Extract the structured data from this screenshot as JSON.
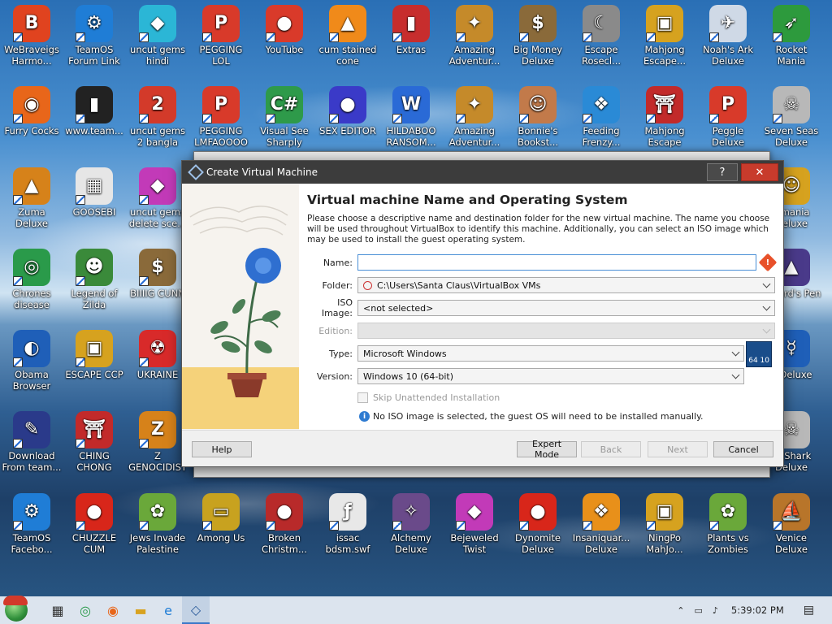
{
  "desktop": {
    "icons": [
      {
        "label": "WeBraveigs Harmo...",
        "color": "#e0431f",
        "glyph": "B"
      },
      {
        "label": "TeamOS Forum Link",
        "color": "#1f7dd6",
        "glyph": "⚙"
      },
      {
        "label": "uncut gems hindi",
        "color": "#2bb6d6",
        "glyph": "◆"
      },
      {
        "label": "PEGGING LOL",
        "color": "#d83a2a",
        "glyph": "P"
      },
      {
        "label": "YouTube",
        "color": "#d93a2a",
        "glyph": "●"
      },
      {
        "label": "cum stained cone",
        "color": "#f08a1a",
        "glyph": "▲"
      },
      {
        "label": "Extras",
        "color": "#c72d2d",
        "glyph": "▮"
      },
      {
        "label": "Amazing Adventur...",
        "color": "#c58a2a",
        "glyph": "✦"
      },
      {
        "label": "Big Money Deluxe",
        "color": "#8a6a3a",
        "glyph": "$"
      },
      {
        "label": "Escape Rosecl...",
        "color": "#8a8a8a",
        "glyph": "☾"
      },
      {
        "label": "Mahjong Escape...",
        "color": "#d6a21f",
        "glyph": "▣"
      },
      {
        "label": "Noah's Ark Deluxe",
        "color": "#cfd9e6",
        "glyph": "✈"
      },
      {
        "label": "Rocket Mania Deluxe",
        "color": "#2d9a3d",
        "glyph": "➶"
      },
      {
        "label": "Furry Cocks",
        "color": "#e8661a",
        "glyph": "◉"
      },
      {
        "label": "www.team...",
        "color": "#222222",
        "glyph": "▮"
      },
      {
        "label": "uncut gems 2 bangla",
        "color": "#d33a2a",
        "glyph": "2"
      },
      {
        "label": "PEGGING LMFAOOOO",
        "color": "#d83a2a",
        "glyph": "P"
      },
      {
        "label": "Visual See Sharply Eve...",
        "color": "#2e9a4a",
        "glyph": "C#"
      },
      {
        "label": "SEX EDITOR",
        "color": "#3a3ac8",
        "glyph": "●"
      },
      {
        "label": "HILDABOO RANSOM...",
        "color": "#2a6ad6",
        "glyph": "W"
      },
      {
        "label": "Amazing Adventur...",
        "color": "#c58a2a",
        "glyph": "✦"
      },
      {
        "label": "Bonnie's Bookst...",
        "color": "#c27a4a",
        "glyph": "☺"
      },
      {
        "label": "Feeding Frenzy...",
        "color": "#2a8ad6",
        "glyph": "❖"
      },
      {
        "label": "Mahjong Escape Anci...",
        "color": "#c22a2a",
        "glyph": "⛩"
      },
      {
        "label": "Peggle Deluxe",
        "color": "#d83a2a",
        "glyph": "P"
      },
      {
        "label": "Seven Seas Deluxe",
        "color": "#b8b8b8",
        "glyph": "☠"
      },
      {
        "label": "Zuma Deluxe",
        "color": "#d6821a",
        "glyph": "▲"
      },
      {
        "label": "GOOSEBI",
        "color": "#e6e6e6",
        "glyph": "▦"
      },
      {
        "label": "uncut gems delete sce...",
        "color": "#c23ab8",
        "glyph": "◆"
      },
      {
        "label": "Chrones disease",
        "color": "#2a9a4a",
        "glyph": "◎"
      },
      {
        "label": "Legend of Zilda",
        "color": "#3a8a3a",
        "glyph": "☻"
      },
      {
        "label": "BIIIIG CUNN",
        "color": "#8a6a3a",
        "glyph": "$"
      },
      {
        "label": "Obama Browser",
        "color": "#1f5fb8",
        "glyph": "◐"
      },
      {
        "label": "ESCAPE CCP",
        "color": "#d6a21f",
        "glyph": "▣"
      },
      {
        "label": "UKRAINE",
        "color": "#d82a2a",
        "glyph": "☢"
      },
      {
        "label": "Download From team...",
        "color": "#2a3a8a",
        "glyph": "✎"
      },
      {
        "label": "CHING CHONG",
        "color": "#c22a2a",
        "glyph": "⛩"
      },
      {
        "label": "Z GENOCIDIST",
        "color": "#d6821a",
        "glyph": "Z"
      },
      {
        "label": "TeamOS Facebo...",
        "color": "#1f7dd6",
        "glyph": "⚙"
      },
      {
        "label": "CHUZZLE CUM",
        "color": "#d8261a",
        "glyph": "●"
      },
      {
        "label": "Jews Invade Palestine",
        "color": "#6aa83a",
        "glyph": "✿"
      },
      {
        "label": "Among Us",
        "color": "#c8a21f",
        "glyph": "▭"
      },
      {
        "label": "Broken Christm...",
        "color": "#b82a2a",
        "glyph": "●"
      },
      {
        "label": "issac bdsm.swf",
        "color": "#e8e8e8",
        "glyph": "ƒ"
      },
      {
        "label": "Alchemy Deluxe",
        "color": "#6a4a8a",
        "glyph": "✧"
      },
      {
        "label": "Bejeweled Twist",
        "color": "#c23ab8",
        "glyph": "◆"
      },
      {
        "label": "Dynomite Deluxe",
        "color": "#d8261a",
        "glyph": "●"
      },
      {
        "label": "Insaniquar... Deluxe",
        "color": "#e8901a",
        "glyph": "❖"
      },
      {
        "label": "NingPo MahJo...",
        "color": "#d6a21f",
        "glyph": "▣"
      },
      {
        "label": "Plants vs Zombies",
        "color": "#6aa83a",
        "glyph": "✿"
      },
      {
        "label": "Venice Deluxe",
        "color": "#b8752a",
        "glyph": "⛵"
      },
      {
        "label": "ismania Deluxe",
        "color": "#d6a21f",
        "glyph": "☺"
      },
      {
        "label": "Wizard's Pen",
        "color": "#4a3a8a",
        "glyph": "▲"
      },
      {
        "label": "p Deluxe",
        "color": "#1f5fb8",
        "glyph": "☿"
      },
      {
        "label": "er Shark Deluxe",
        "color": "#b8b8b8",
        "glyph": "☠"
      }
    ]
  },
  "dialog": {
    "title": "Create Virtual Machine",
    "help_glyph": "?",
    "close_glyph": "✕",
    "heading": "Virtual machine Name and Operating System",
    "description": "Please choose a descriptive name and destination folder for the new virtual machine. The name you choose will be used throughout VirtualBox to identify this machine. Additionally, you can select an ISO image which may be used to install the guest operating system.",
    "fields": {
      "name_label": "Name:",
      "name_value": "",
      "folder_label": "Folder:",
      "folder_value": "C:\\Users\\Santa Claus\\VirtualBox VMs",
      "iso_label": "ISO Image:",
      "iso_value": "<not selected>",
      "edition_label": "Edition:",
      "edition_value": "",
      "type_label": "Type:",
      "type_value": "Microsoft Windows",
      "version_label": "Version:",
      "version_value": "Windows 10 (64-bit)"
    },
    "os_badge": "64 10",
    "skip_label": "Skip Unattended Installation",
    "info_text": "No ISO image is selected, the guest OS will need to be installed manually.",
    "buttons": {
      "help": "Help",
      "expert": "Expert Mode",
      "back": "Back",
      "next": "Next",
      "cancel": "Cancel"
    }
  },
  "taskbar": {
    "icons": [
      "task-view-icon",
      "chrome-icon",
      "firefox-icon",
      "file-explorer-icon",
      "edge-icon",
      "virtualbox-icon"
    ],
    "clock": "5:39:02 PM"
  }
}
